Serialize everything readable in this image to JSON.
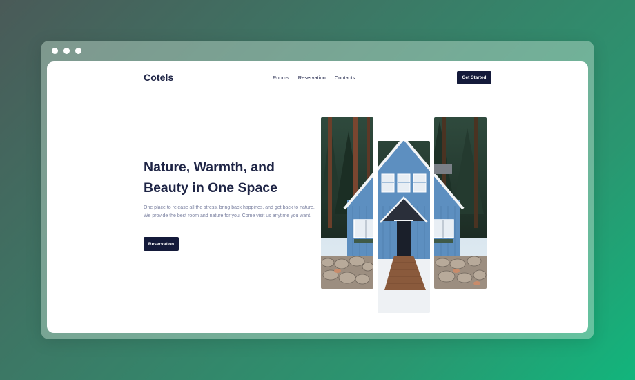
{
  "window": {
    "controls": [
      "dot",
      "dot",
      "dot"
    ]
  },
  "header": {
    "logo": "Cotels",
    "nav": [
      "Rooms",
      "Reservation",
      "Contacts"
    ],
    "cta_label": "Get Started"
  },
  "hero": {
    "title_line1": "Nature, Warmth, and",
    "title_line2": "Beauty in One Space",
    "description": "One place to release all the stress, bring back happines, and get back to nature. We provide the best room and nature for you. Come visit us anytime you want.",
    "button_label": "Reservation"
  },
  "gallery": {
    "image_subject": "blue wooden cabin in a pine forest with snow and stone wall",
    "panels": 3
  },
  "colors": {
    "navy": "#141a3a",
    "text_dark": "#1e2445",
    "text_muted": "#7a80a0",
    "cabin_blue": "#5d8fc0",
    "bg_gradient_start": "#4a5a58",
    "bg_gradient_end": "#12b57c"
  }
}
